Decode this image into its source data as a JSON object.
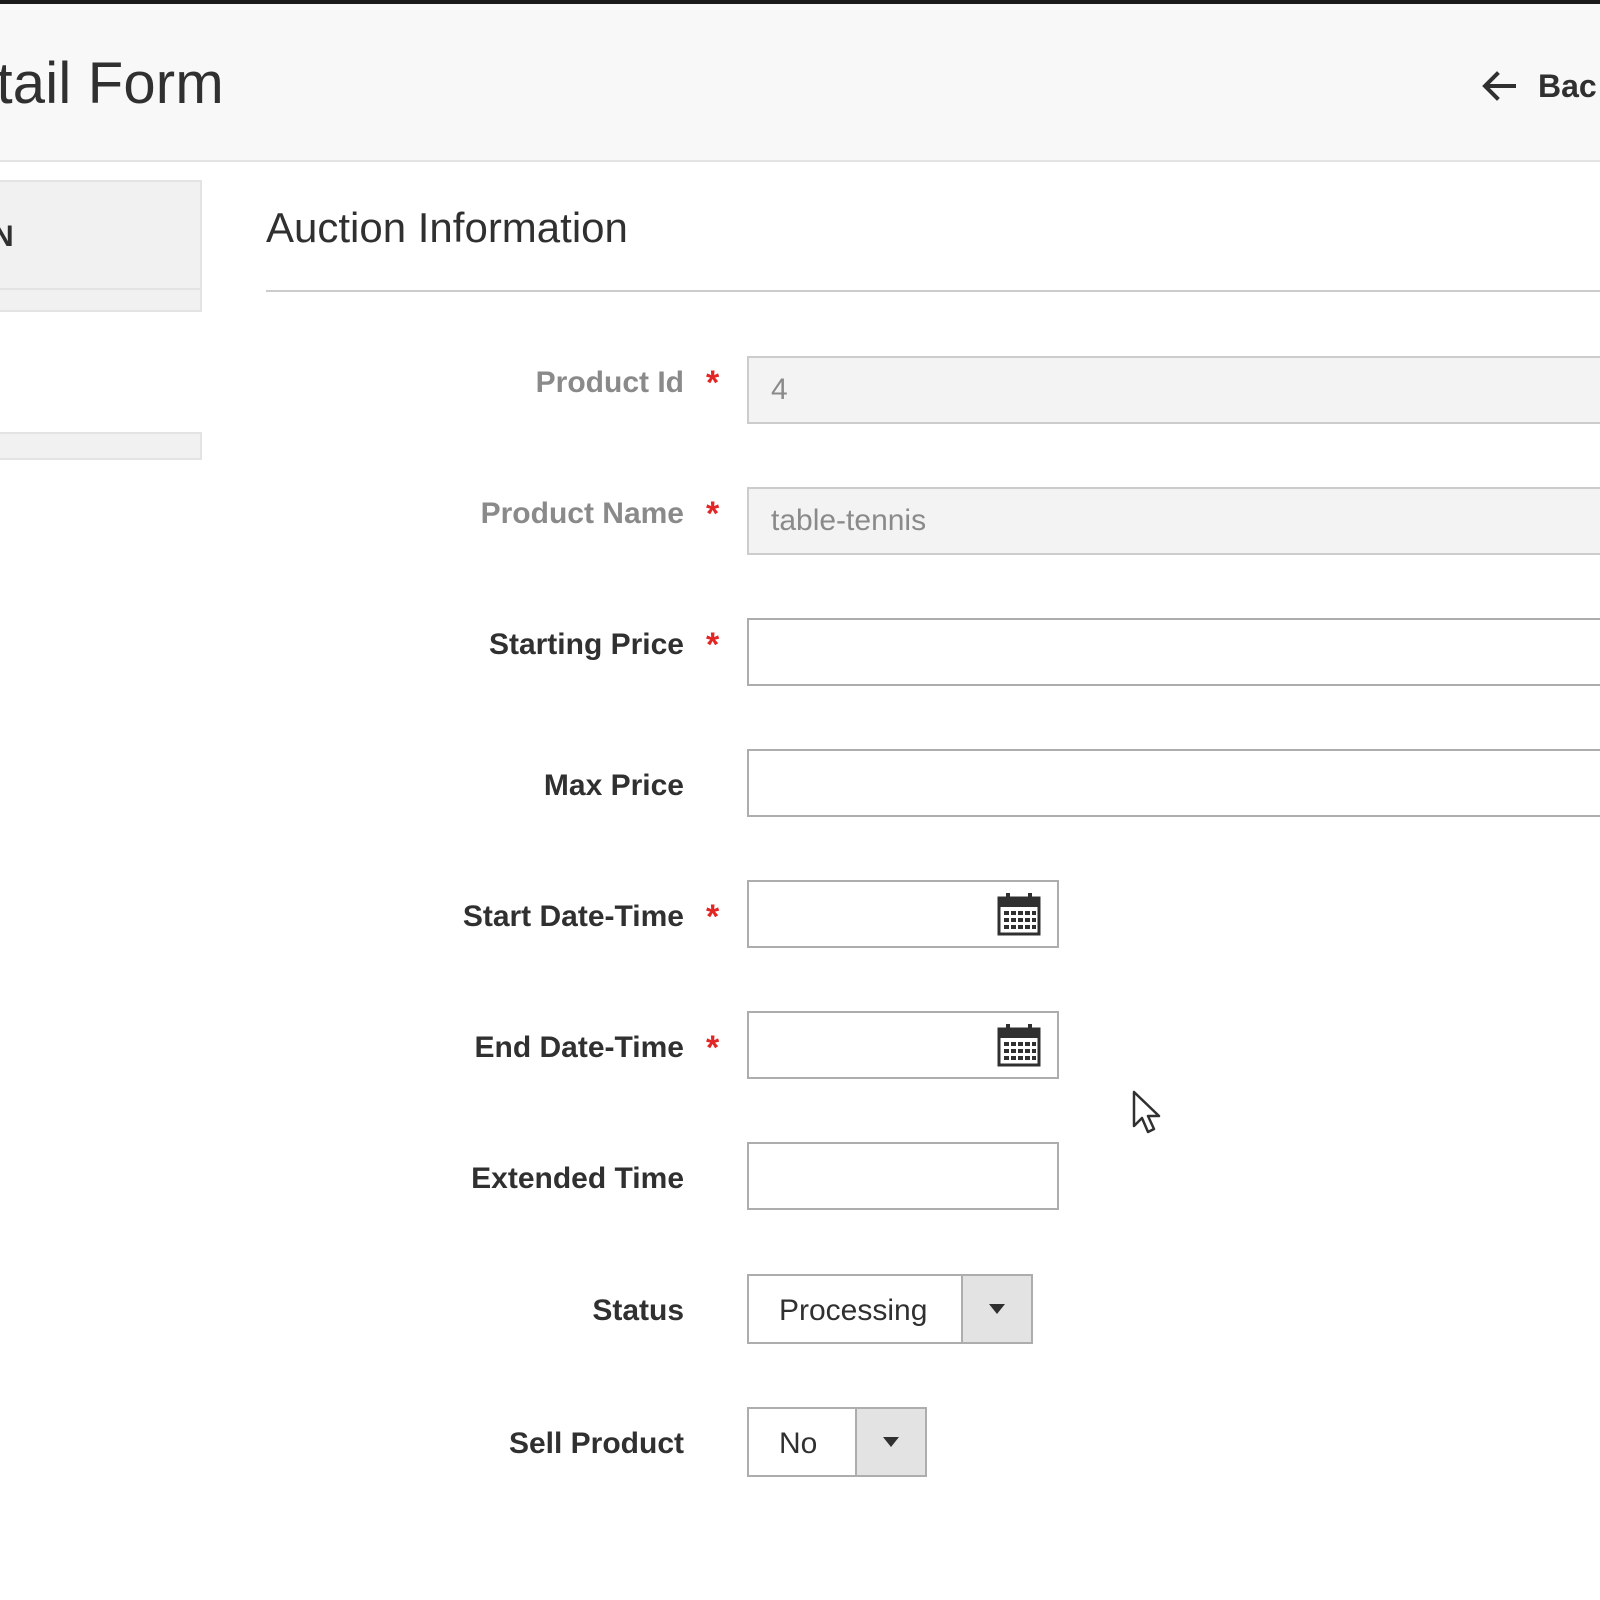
{
  "header": {
    "title": "etail Form",
    "back_label": "Bac"
  },
  "side_nav": {
    "active_tab_label": "N"
  },
  "section": {
    "title": "Auction Information"
  },
  "fields": {
    "product_id": {
      "label": "Product Id",
      "value": "4",
      "required": "*"
    },
    "product_name": {
      "label": "Product Name",
      "value": "table-tennis",
      "required": "*"
    },
    "starting_price": {
      "label": "Starting Price",
      "value": "",
      "required": "*"
    },
    "max_price": {
      "label": "Max Price",
      "value": ""
    },
    "start_datetime": {
      "label": "Start Date-Time",
      "value": "",
      "required": "*"
    },
    "end_datetime": {
      "label": "End Date-Time",
      "value": "",
      "required": "*"
    },
    "extended_time": {
      "label": "Extended Time",
      "value": ""
    },
    "status": {
      "label": "Status",
      "value": "Processing"
    },
    "sell_product": {
      "label": "Sell Product",
      "value": "No"
    }
  },
  "icons": {
    "back": "arrow-left-icon",
    "calendar": "calendar-icon",
    "dropdown": "caret-down-icon",
    "cursor": "mouse-pointer-icon"
  },
  "colors": {
    "required_star": "#e22626",
    "header_bg": "#f8f8f8",
    "disabled_bg": "#f3f3f3",
    "caret_bg": "#e3e3e3"
  }
}
